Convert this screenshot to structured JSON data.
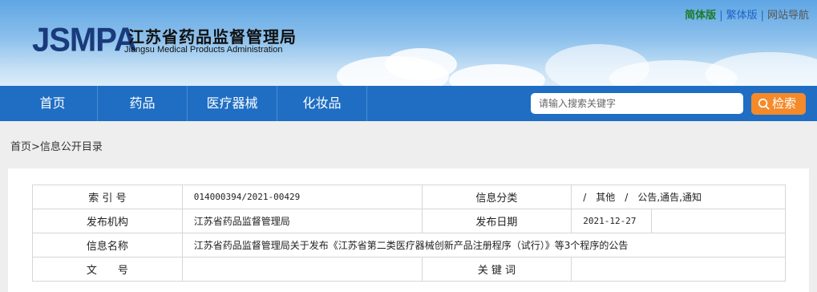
{
  "header": {
    "logo_mark": "JSMPA",
    "logo_cn": "江苏省药品监督管理局",
    "logo_en": "Jiangsu Medical Products Administration",
    "links": [
      "简体版",
      "繁体版",
      "网站导航"
    ],
    "separator": "|"
  },
  "nav": {
    "items": [
      "首页",
      "药品",
      "医疗器械",
      "化妆品"
    ],
    "search_placeholder": "请输入搜索关键字",
    "search_label": "检索"
  },
  "breadcrumb": {
    "home": "首页",
    "separator": ">",
    "current": "信息公开目录"
  },
  "info": {
    "index_label": "索 引 号",
    "index_value": "014000394/2021-00429",
    "category_label": "信息分类",
    "category_value": "/　其他　/　公告,通告,通知",
    "publisher_label": "发布机构",
    "publisher_value": "江苏省药品监督管理局",
    "date_label": "发布日期",
    "date_value": "2021-12-27",
    "name_label": "信息名称",
    "name_value": "江苏省药品监督管理局关于发布《江苏省第二类医疗器械创新产品注册程序（试行）》等3个程序的公告",
    "doc_label": "文　　号",
    "doc_value": "",
    "keyword_label": "关 键 词",
    "keyword_value": ""
  }
}
